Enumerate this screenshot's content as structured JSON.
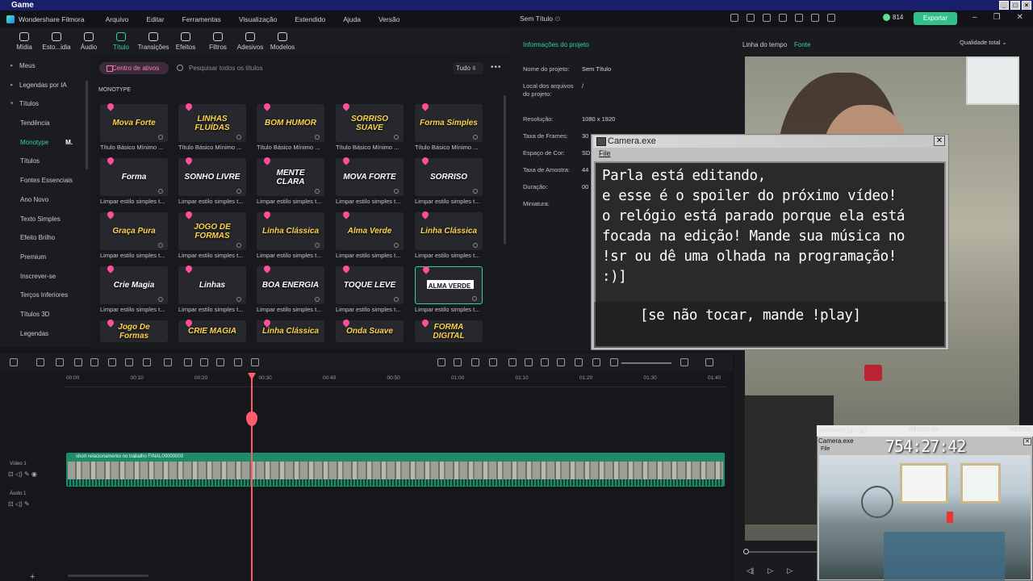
{
  "gamebar": {
    "title": "Game"
  },
  "menu": [
    "Arquivo",
    "Editar",
    "Ferramentas",
    "Visualização",
    "Estendido",
    "Ajuda",
    "Versão"
  ],
  "app": {
    "name": "Wondershare Filmora",
    "project": "Sem Título",
    "coins": "814",
    "export_label": "Exportar"
  },
  "toolbar": [
    "Mídia",
    "Esto...idia",
    "Áudio",
    "Título",
    "Transições",
    "Efeitos",
    "Filtros",
    "Adesivos",
    "Modelos"
  ],
  "tree": [
    {
      "label": "Meus",
      "section": true
    },
    {
      "label": "Legendas por IA",
      "section": true
    },
    {
      "label": "Títulos",
      "section": true,
      "open": true
    },
    {
      "label": "Tendência"
    },
    {
      "label": "Monotype",
      "active": true,
      "badge": "M."
    },
    {
      "label": "Títulos"
    },
    {
      "label": "Fontes Essenciais"
    },
    {
      "label": "Ano Novo"
    },
    {
      "label": "Texto Simples"
    },
    {
      "label": "Efeito Brilho"
    },
    {
      "label": "Premium"
    },
    {
      "label": "Inscrever-se"
    },
    {
      "label": "Terços Inferiores"
    },
    {
      "label": "Títulos 3D"
    },
    {
      "label": "Legendas"
    }
  ],
  "assets": {
    "centro": "Centro de ativos",
    "search_placeholder": "Pesquisar todos os títulos",
    "filter": "Tudo",
    "section": "MONOTYPE",
    "rows": [
      {
        "caption": "Título Básico Mínimo ...",
        "items": [
          "Mova Forte",
          "LINHAS FLUÍDAS",
          "BOM HUMOR",
          "SORRISO SUAVE",
          "Forma Simples"
        ]
      },
      {
        "caption": "Limpar estilo simples t...",
        "items": [
          "Forma",
          "SONHO LIVRE",
          "MENTE CLARA",
          "MOVA FORTE",
          "SORRISO"
        ]
      },
      {
        "caption": "Limpar estilo simples t...",
        "items": [
          "Graça Pura",
          "JOGO DE FORMAS",
          "Linha Clássica",
          "Alma Verde",
          "Linha Clássica"
        ]
      },
      {
        "caption": "Limpar estilo simples t...",
        "items": [
          "Crie Magia",
          "Linhas",
          "BOA ENERGIA",
          "TOQUE LEVE",
          "ALMA VERDE"
        ]
      },
      {
        "caption": "",
        "items": [
          "Jogo De Formas",
          "CRIE MAGIA",
          "Linha Clássica",
          "Onda Suave",
          "FORMA DIGITAL"
        ]
      }
    ]
  },
  "info": {
    "header": "Informações do projeto",
    "rows": [
      {
        "label": "Nome do projeto:",
        "value": "Sem Título"
      },
      {
        "label": "Local dos arquivos do projeto:",
        "value": "/"
      },
      {
        "label": "Resolução:",
        "value": "1080 x 1920"
      },
      {
        "label": "Taxa de Frames:",
        "value": "30"
      },
      {
        "label": "Espaço de Cor:",
        "value": "SD"
      },
      {
        "label": "Taxa de Amostra:",
        "value": "44"
      },
      {
        "label": "Duração:",
        "value": "00"
      },
      {
        "label": "Miniatura:",
        "value": ""
      }
    ]
  },
  "preview": {
    "header": "Linha do tempo",
    "font_tab": "Fonte",
    "quality": "Qualidade total"
  },
  "camera_popup": {
    "title": "Camera.exe",
    "menu": "File",
    "message": "Parla está editando,\ne esse é o spoiler do próximo vídeo!\no relógio está parado porque ela está\nfocada na edição! Mande sua música no\n!sr ou dê uma olhada na programação!\n:)]",
    "play_hint": "[se não tocar, mande !play]"
  },
  "timeline": {
    "ruler": [
      "00:00",
      "00:10",
      "00:20",
      "00:30",
      "00:40",
      "00:50",
      "01:00",
      "01:10",
      "01:20",
      "01:30",
      "01:40"
    ],
    "clip_label": "short relacionamento no trabalho FINAL00000000",
    "track_video": "Vídeo 1",
    "track_audio": "Áudio 1"
  },
  "webcam": {
    "month": "fev/março (╥﹏╥)",
    "rs1": "R$1612.63",
    "rs2": "R$1650",
    "title": "Camera.exe",
    "file": "File",
    "clock": "754:27:42"
  }
}
